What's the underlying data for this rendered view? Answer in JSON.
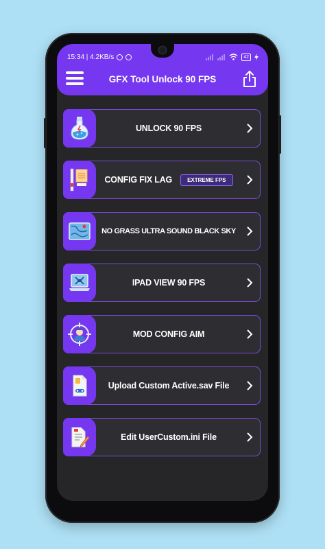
{
  "status_bar": {
    "time_speed": "15:34 | 4.2KB/s",
    "battery": "42"
  },
  "app_bar": {
    "title": "GFX Tool Unlock 90 FPS",
    "menu_icon": "hamburger-menu-icon",
    "share_icon": "share-icon"
  },
  "menu_items": [
    {
      "label": "UNLOCK 90 FPS",
      "icon": "potion-flask-icon"
    },
    {
      "label": "CONFIG FIX LAG",
      "badge": "EXTREME FPS",
      "icon": "fist-power-icon"
    },
    {
      "label": "NO GRASS ULTRA SOUND BLACK SKY",
      "icon": "map-icon"
    },
    {
      "label": "IPAD VIEW 90 FPS",
      "icon": "laptop-screen-icon"
    },
    {
      "label": "MOD CONFIG AIM",
      "icon": "crosshair-target-icon"
    },
    {
      "label": "Upload Custom Active.sav File",
      "icon": "file-upload-icon"
    },
    {
      "label": "Edit UserCustom.ini File",
      "icon": "file-edit-icon"
    }
  ],
  "colors": {
    "background": "#aee0f5",
    "accent": "#7637f0",
    "card": "#2e2e32",
    "screen": "#262629"
  }
}
